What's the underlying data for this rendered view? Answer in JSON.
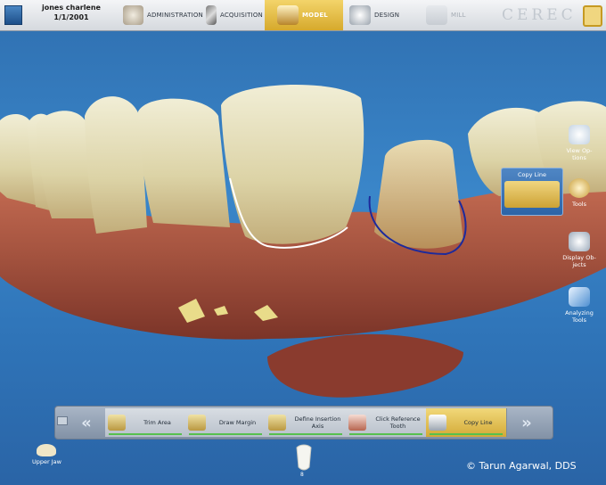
{
  "patient": {
    "name": "jones charlene",
    "dob": "1/1/2001"
  },
  "phases": [
    {
      "label": "ADMINISTRATION",
      "state": "normal"
    },
    {
      "label": "ACQUISITION",
      "state": "normal"
    },
    {
      "label": "MODEL",
      "state": "active"
    },
    {
      "label": "DESIGN",
      "state": "normal"
    },
    {
      "label": "MILL",
      "state": "disabled"
    }
  ],
  "brand": "CEREC",
  "right_tools": {
    "view_options": "View Op-\ntions",
    "tools": "Tools",
    "display_objects": "Display Ob-\njects",
    "analyzing_tools": "Analyzing\nTools"
  },
  "copy_line_popup": "Copy Line",
  "wizard_steps": [
    {
      "label": "Trim Area",
      "active": false
    },
    {
      "label": "Draw Margin",
      "active": false
    },
    {
      "label": "Define Insertion\nAxis",
      "active": false
    },
    {
      "label": "Click Reference\nTooth",
      "active": false
    },
    {
      "label": "Copy Line",
      "active": true
    }
  ],
  "wizard_nav": {
    "prev": "«",
    "next": "»"
  },
  "jaw_button": "Upper Jaw",
  "selected_tooth_number": "8",
  "copyright": "© Tarun Agarwal, DDS",
  "colors": {
    "accent": "#e2b93b",
    "margin_line_white": "#ffffff",
    "margin_line_blue": "#1d2a9c",
    "progress": "#56c04e"
  }
}
